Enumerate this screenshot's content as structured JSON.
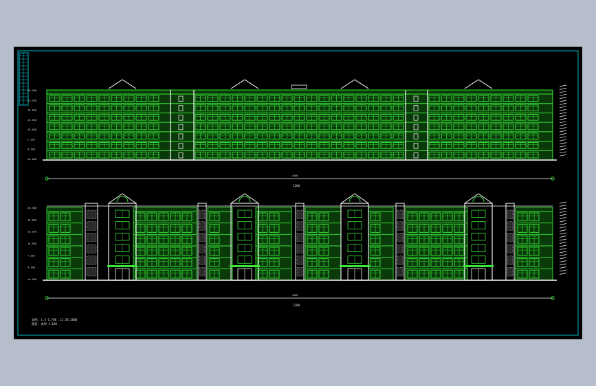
{
  "colors": {
    "background": "#b6bdcb",
    "canvas": "#000000",
    "frame": "#00b7c4",
    "window": "#39e639",
    "structure": "#ffffff",
    "text": "#dcdcdc"
  },
  "icons": {
    "axis_marker": "green-circle-icon",
    "pediment": "triangle-roof-icon"
  },
  "drawing": {
    "upper_elevation": {
      "floors": 7,
      "width_label": "4400",
      "total_label": "2200",
      "level_tags": [
        "20.580",
        "19.950",
        "16.800",
        "13.650",
        "10.500",
        "7.350",
        "4.200",
        "±0.000"
      ]
    },
    "lower_elevation": {
      "floors": 6,
      "width_label": "4400",
      "total_label": "2200",
      "level_tags": [
        "20.580",
        "16.800",
        "13.650",
        "10.500",
        "7.350",
        "4.200",
        "±0.000"
      ]
    },
    "notes": [
      "说明: 1.5-1.700 ,12.50,2000",
      "屋面: 说明 1:100"
    ]
  }
}
